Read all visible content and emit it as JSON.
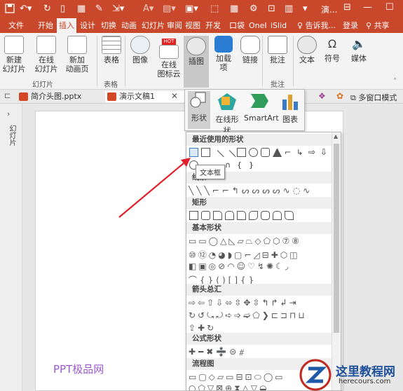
{
  "titlebar": {
    "window_title": "演...",
    "qa_icons": [
      "save-icon",
      "undo-icon",
      "redo-icon",
      "new-file-icon",
      "grid-icon",
      "brush-icon",
      "export-icon",
      "font-color-icon",
      "paste-icon",
      "text-tool-icon",
      "shape-icon",
      "table-icon"
    ]
  },
  "tabs": [
    "文件",
    "开始",
    "插入",
    "设计",
    "切换",
    "动画",
    "幻灯片",
    "审阅",
    "视图",
    "开发",
    "口袋",
    "OneI",
    "iSlid",
    "告诉我...",
    "登录",
    "共享"
  ],
  "ribbon": {
    "slides_group": {
      "label": "幻灯片",
      "new_slide": "新建\n幻灯片",
      "online_slide": "在线\n幻灯片",
      "new_anim_page": "新加\n动画页"
    },
    "table_group": {
      "label": "表格",
      "table": "表格"
    },
    "image": "图像",
    "online_icons": "在线\n图标云",
    "hot_badge": "HOT",
    "illustrations": "插图",
    "addins": "加载\n项",
    "links": "链接",
    "comments_group": {
      "label": "批注",
      "comment": "批注"
    },
    "text": "文本",
    "symbols": "符号",
    "media": "媒体"
  },
  "doctabs": {
    "tab1": "简介头图.pptx",
    "tab2": "演示文稿1",
    "multi_window": "多窗口模式"
  },
  "leftpanel": {
    "label": "幻灯片"
  },
  "illustrations_menu": {
    "shapes": "形状",
    "online_shapes": "在线形状",
    "smartart": "SmartArt",
    "chart": "图表"
  },
  "gallery": {
    "recent": "最近使用的形状",
    "lines": "线条",
    "rect": "矩形",
    "basic": "基本形状",
    "arrows": "箭头总汇",
    "equation": "公式形状",
    "flowchart": "流程图"
  },
  "tooltip": "文本框",
  "watermark": "PPT极品网",
  "logo": {
    "title": "这里教程网",
    "url": "herecours.com"
  },
  "colors": {
    "accent": "#c9472a",
    "arrow": "#e0202a"
  }
}
